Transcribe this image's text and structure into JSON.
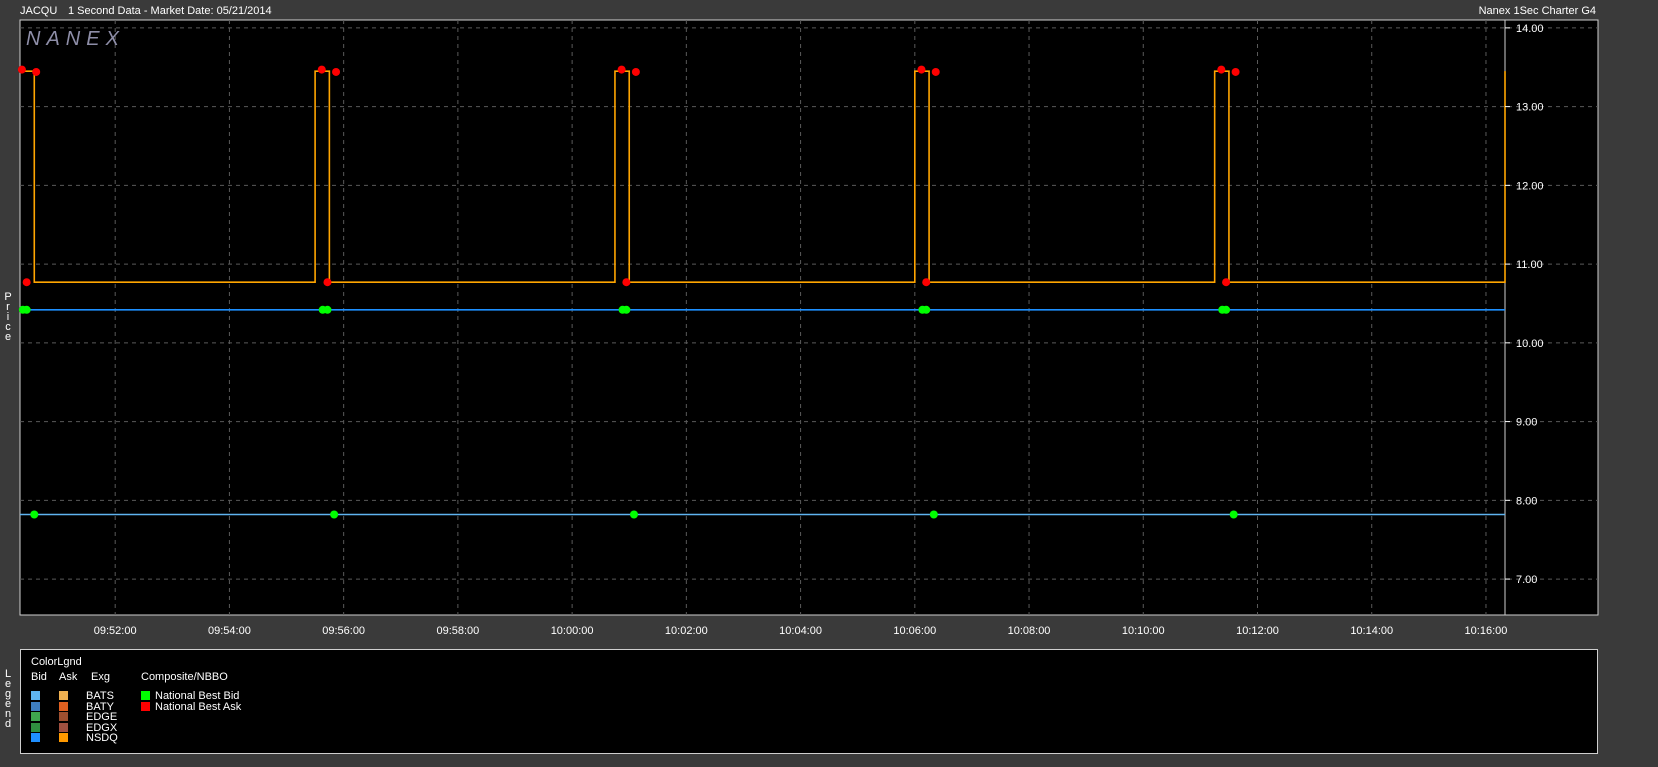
{
  "header": {
    "symbol": "JACQU",
    "description": "1 Second Data - Market Date: 05/21/2014",
    "brand": "Nanex 1Sec Charter G4"
  },
  "watermark": "NANEX",
  "y_axis_side_label": "Price",
  "legend_side_label": "Legend",
  "legend": {
    "title": "ColorLgnd",
    "col_bid": "Bid",
    "col_ask": "Ask",
    "col_exg": "Exg",
    "col_composite": "Composite/NBBO",
    "exchanges": [
      {
        "name": "BATS",
        "bid_color": "#5fb4f0",
        "ask_color": "#f0b050"
      },
      {
        "name": "BATY",
        "bid_color": "#3f7fc0",
        "ask_color": "#e06020"
      },
      {
        "name": "EDGE",
        "bid_color": "#3fa84f",
        "ask_color": "#a05030"
      },
      {
        "name": "EDGX",
        "bid_color": "#2f8f3f",
        "ask_color": "#a05040"
      },
      {
        "name": "NSDQ",
        "bid_color": "#1f8fff",
        "ask_color": "#ff9900"
      }
    ],
    "composite": [
      {
        "name": "National Best Bid",
        "color": "#00ff00"
      },
      {
        "name": "National Best Ask",
        "color": "#ff0000"
      }
    ]
  },
  "colors": {
    "background": "#000000",
    "frame": "#3a3a3a",
    "grid": "#5a5a5a",
    "ask_line": "#ffa500",
    "nsdq_bid_line": "#1e90ff",
    "bats_bid_line": "#5fb4f0",
    "nbb_marker": "#00ff00",
    "nba_marker": "#ff0000"
  },
  "chart_data": {
    "type": "line",
    "x_axis": {
      "range": [
        "09:50:20",
        "10:16:20"
      ],
      "ticks": [
        "09:52:00",
        "09:54:00",
        "09:56:00",
        "09:58:00",
        "10:00:00",
        "10:02:00",
        "10:04:00",
        "10:06:00",
        "10:08:00",
        "10:10:00",
        "10:12:00",
        "10:14:00",
        "10:16:00"
      ]
    },
    "y_axis": {
      "range": [
        6.95,
        14.1
      ],
      "ticks": [
        "14.00",
        "13.00",
        "12.00",
        "11.00",
        "10.00",
        "9.00",
        "8.00",
        "7.00"
      ],
      "position": "right"
    },
    "grid": true,
    "series": [
      {
        "key": "ask",
        "type": "step",
        "base": 13.45,
        "dip": 10.77,
        "dip_windows": [
          [
            "09:50:35",
            "09:55:30"
          ],
          [
            "09:55:45",
            "10:00:45"
          ],
          [
            "10:01:00",
            "10:06:00"
          ],
          [
            "10:06:15",
            "10:11:15"
          ],
          [
            "10:11:30",
            "10:16:20"
          ]
        ]
      },
      {
        "key": "nsdq_bid",
        "type": "line",
        "value": 10.42
      },
      {
        "key": "bats_bid",
        "type": "line",
        "value": 7.82
      }
    ],
    "markers": {
      "nba": [
        [
          "09:50:22",
          13.47
        ],
        [
          "09:50:37",
          13.44
        ],
        [
          "09:50:27",
          10.77
        ],
        [
          "09:55:37",
          13.47
        ],
        [
          "09:55:52",
          13.44
        ],
        [
          "09:55:43",
          10.77
        ],
        [
          "10:00:52",
          13.47
        ],
        [
          "10:01:07",
          13.44
        ],
        [
          "10:00:57",
          10.77
        ],
        [
          "10:06:07",
          13.47
        ],
        [
          "10:06:22",
          13.44
        ],
        [
          "10:06:12",
          10.77
        ],
        [
          "10:11:22",
          13.47
        ],
        [
          "10:11:37",
          13.44
        ],
        [
          "10:11:27",
          10.77
        ]
      ],
      "nbb": [
        [
          "09:50:23",
          10.42
        ],
        [
          "09:50:27",
          10.42
        ],
        [
          "09:55:38",
          10.42
        ],
        [
          "09:55:43",
          10.42
        ],
        [
          "10:00:53",
          10.42
        ],
        [
          "10:00:57",
          10.42
        ],
        [
          "10:06:08",
          10.42
        ],
        [
          "10:06:12",
          10.42
        ],
        [
          "10:11:23",
          10.42
        ],
        [
          "10:11:27",
          10.42
        ],
        [
          "09:50:35",
          7.82
        ],
        [
          "09:55:50",
          7.82
        ],
        [
          "10:01:05",
          7.82
        ],
        [
          "10:06:20",
          7.82
        ],
        [
          "10:11:35",
          7.82
        ]
      ]
    }
  }
}
